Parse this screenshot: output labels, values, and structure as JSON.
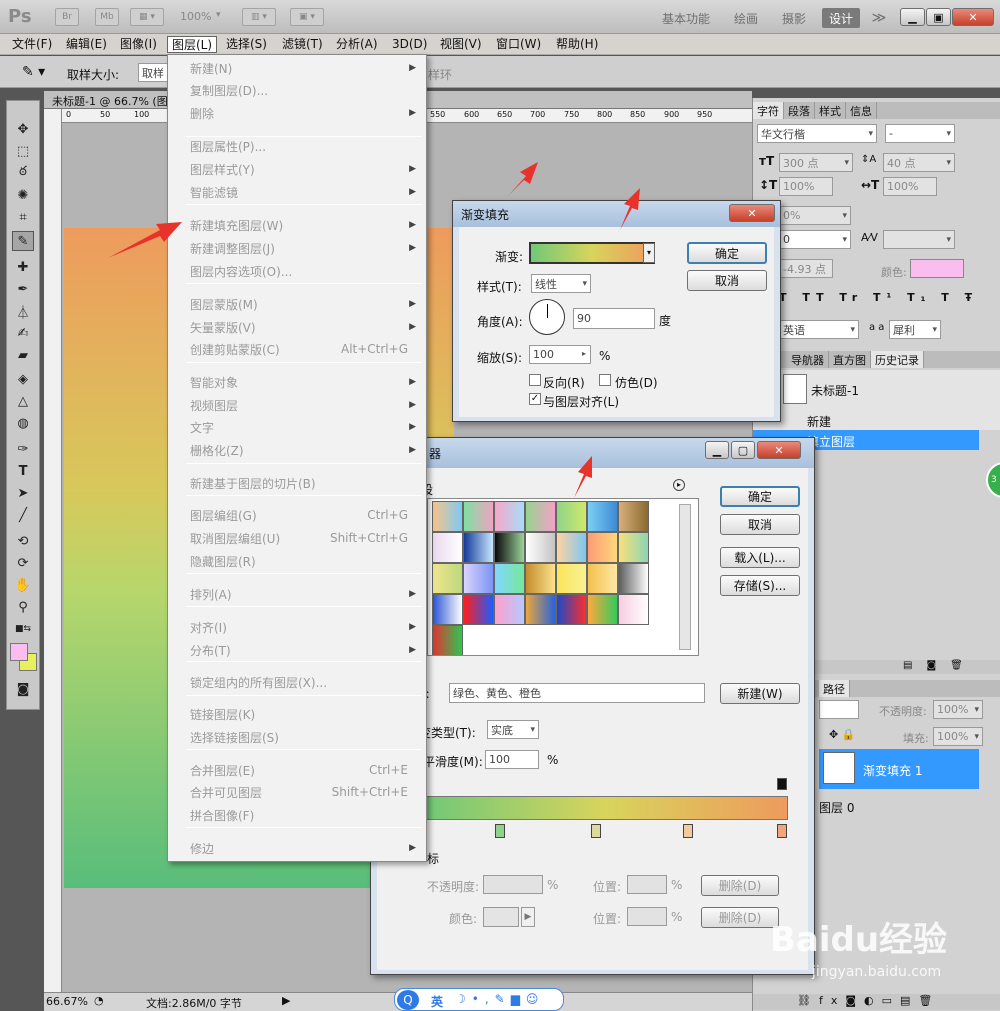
{
  "app": {
    "logo": "Ps",
    "br": "Br",
    "mb": "Mb",
    "zoom": "100%",
    "workspaces": [
      "基本功能",
      "绘画",
      "摄影",
      "设计"
    ],
    "more": "≫"
  },
  "menubar": [
    "文件(F)",
    "编辑(E)",
    "图像(I)",
    "图层(L)",
    "选择(S)",
    "滤镜(T)",
    "分析(A)",
    "3D(D)",
    "视图(V)",
    "窗口(W)",
    "帮助(H)"
  ],
  "options": {
    "sample_label": "取样大小:",
    "sample_value": "取样",
    "ring": "样环"
  },
  "document": {
    "tab": "未标题-1 @ 66.7% (图",
    "ruler_left": [
      "0",
      "50",
      "100"
    ],
    "ruler_right": [
      "550",
      "600",
      "650",
      "700",
      "750",
      "800",
      "850",
      "900",
      "950"
    ],
    "status_zoom": "66.67%",
    "status_doc": "文档:2.86M/0 字节"
  },
  "layer_menu": {
    "items": [
      {
        "label": "新建(N)",
        "shortcut": "",
        "submenu": true
      },
      {
        "label": "复制图层(D)...",
        "shortcut": "",
        "submenu": false
      },
      {
        "label": "删除",
        "shortcut": "",
        "submenu": true
      },
      {
        "label": "图层属性(P)...",
        "shortcut": "",
        "submenu": false
      },
      {
        "label": "图层样式(Y)",
        "shortcut": "",
        "submenu": true
      },
      {
        "label": "智能滤镜",
        "shortcut": "",
        "submenu": true
      },
      {
        "label": "新建填充图层(W)",
        "shortcut": "",
        "submenu": true
      },
      {
        "label": "新建调整图层(J)",
        "shortcut": "",
        "submenu": true
      },
      {
        "label": "图层内容选项(O)...",
        "shortcut": "",
        "submenu": false
      },
      {
        "label": "图层蒙版(M)",
        "shortcut": "",
        "submenu": true
      },
      {
        "label": "矢量蒙版(V)",
        "shortcut": "",
        "submenu": true
      },
      {
        "label": "创建剪贴蒙版(C)",
        "shortcut": "Alt+Ctrl+G",
        "submenu": false
      },
      {
        "label": "智能对象",
        "shortcut": "",
        "submenu": true
      },
      {
        "label": "视频图层",
        "shortcut": "",
        "submenu": true
      },
      {
        "label": "文字",
        "shortcut": "",
        "submenu": true
      },
      {
        "label": "栅格化(Z)",
        "shortcut": "",
        "submenu": true
      },
      {
        "label": "新建基于图层的切片(B)",
        "shortcut": "",
        "submenu": false
      },
      {
        "label": "图层编组(G)",
        "shortcut": "Ctrl+G",
        "submenu": false
      },
      {
        "label": "取消图层编组(U)",
        "shortcut": "Shift+Ctrl+G",
        "submenu": false
      },
      {
        "label": "隐藏图层(R)",
        "shortcut": "",
        "submenu": false
      },
      {
        "label": "排列(A)",
        "shortcut": "",
        "submenu": true
      },
      {
        "label": "对齐(I)",
        "shortcut": "",
        "submenu": true
      },
      {
        "label": "分布(T)",
        "shortcut": "",
        "submenu": true
      },
      {
        "label": "锁定组内的所有图层(X)...",
        "shortcut": "",
        "submenu": false
      },
      {
        "label": "链接图层(K)",
        "shortcut": "",
        "submenu": false
      },
      {
        "label": "选择链接图层(S)",
        "shortcut": "",
        "submenu": false
      },
      {
        "label": "合并图层(E)",
        "shortcut": "Ctrl+E",
        "submenu": false
      },
      {
        "label": "合并可见图层",
        "shortcut": "Shift+Ctrl+E",
        "submenu": false
      },
      {
        "label": "拼合图像(F)",
        "shortcut": "",
        "submenu": false
      },
      {
        "label": "修边",
        "shortcut": "",
        "submenu": true
      }
    ]
  },
  "gradient_fill": {
    "title": "渐变填充",
    "gradient_label": "渐变:",
    "style_label": "样式(T):",
    "style_value": "线性",
    "angle_label": "角度(A):",
    "angle_value": "90",
    "angle_unit": "度",
    "scale_label": "缩放(S):",
    "scale_value": "100",
    "scale_unit": "%",
    "reverse": "反向(R)",
    "dither": "仿色(D)",
    "align": "与图层对齐(L)",
    "ok": "确定",
    "cancel": "取消"
  },
  "gradient_editor": {
    "title": "器",
    "presets_label": "设",
    "ok": "确定",
    "cancel": "取消",
    "load": "载入(L)...",
    "save": "存储(S)...",
    "name_label": "):",
    "name_value": "绿色、黄色、橙色",
    "new": "新建(W)",
    "type_label": "变类型(T):",
    "type_value": "实底",
    "smooth_label": "平滑度(M):",
    "smooth_value": "100",
    "smooth_unit": "%",
    "stops_label": "标",
    "opacity_label": "不透明度:",
    "color_label": "颜色:",
    "position_label": "位置:",
    "pct": "%",
    "delete": "删除(D)"
  },
  "char_panel": {
    "tabs": [
      "字符",
      "段落",
      "样式",
      "信息"
    ],
    "font": "华文行楷",
    "font_style": "-",
    "size": "300 点",
    "leading": "40 点",
    "vscale": "100%",
    "hscale": "100%",
    "tracking": "0%",
    "kerning": "0",
    "baseline": "-4.93 点",
    "color_label": "颜色:",
    "language": "英语",
    "aa_label": "a a",
    "aa": "犀利"
  },
  "history_panel": {
    "tabs": [
      "导航器",
      "直方图",
      "历史记录"
    ],
    "snapshot": "未标题-1",
    "items": [
      "新建",
      "填立图层"
    ]
  },
  "layers_panel": {
    "tab": "路径",
    "opacity_label": "不透明度:",
    "opacity": "100%",
    "fill_label": "填充:",
    "fill": "100%",
    "layers": [
      "渐变填充 1",
      "图层 0"
    ]
  },
  "ime_bar": {
    "lang": "英"
  },
  "watermark": {
    "brand": "Baidu经验",
    "url": "jingyan.baidu.com"
  },
  "colors": {
    "accent_blue": "#3399ff",
    "red_arrow": "#e8322c",
    "fg_swatch": "#f9bdf0",
    "bg_swatch": "#e8f060"
  },
  "gradient_presets": [
    [
      "#f7c48a,#7fc9f2",
      "#7fe0a1,#f0a3c2",
      "#f7a7c8,#a8dcf7",
      "#96d38d,#f4a1c9",
      "#90d489,#d0e96b",
      "#7bd0f3,#3e8ad6",
      "#d7b07d,#8a6a2f"
    ],
    [
      "#e9d9ee,#ffffff",
      "#163c9a,#c8e7ff",
      "#0a0a0a,#9dd39a",
      "#ffffff,#c4c4c4",
      "#ffd3a1,#7ec7f2",
      "#ff9b76,#ffd77a",
      "#f9e27a,#8cd3b6"
    ],
    [
      "#f0e68c,#bcd87e",
      "#dad3ff,#7b94f4",
      "#80d7ff,#76e899",
      "#c48d2d,#fbe28c",
      "#fbe45a,#f7f295",
      "#f2c04e,#ffe8a3",
      "#5e5e5e,#ffffff"
    ],
    [
      "#2d55d6,#ffffff",
      "#ff1e1e,#1e5cff",
      "#ff9fcb,#b5c9ff",
      "#e9a73d,#2a62d9",
      "#1c48c6,#ff2d2d",
      "#ffa93d,#35c95c",
      "#f8cde0,#ffffff"
    ],
    [
      "#e03530,#2ec653",
      "",
      "",
      "",
      "",
      ""
    ]
  ]
}
